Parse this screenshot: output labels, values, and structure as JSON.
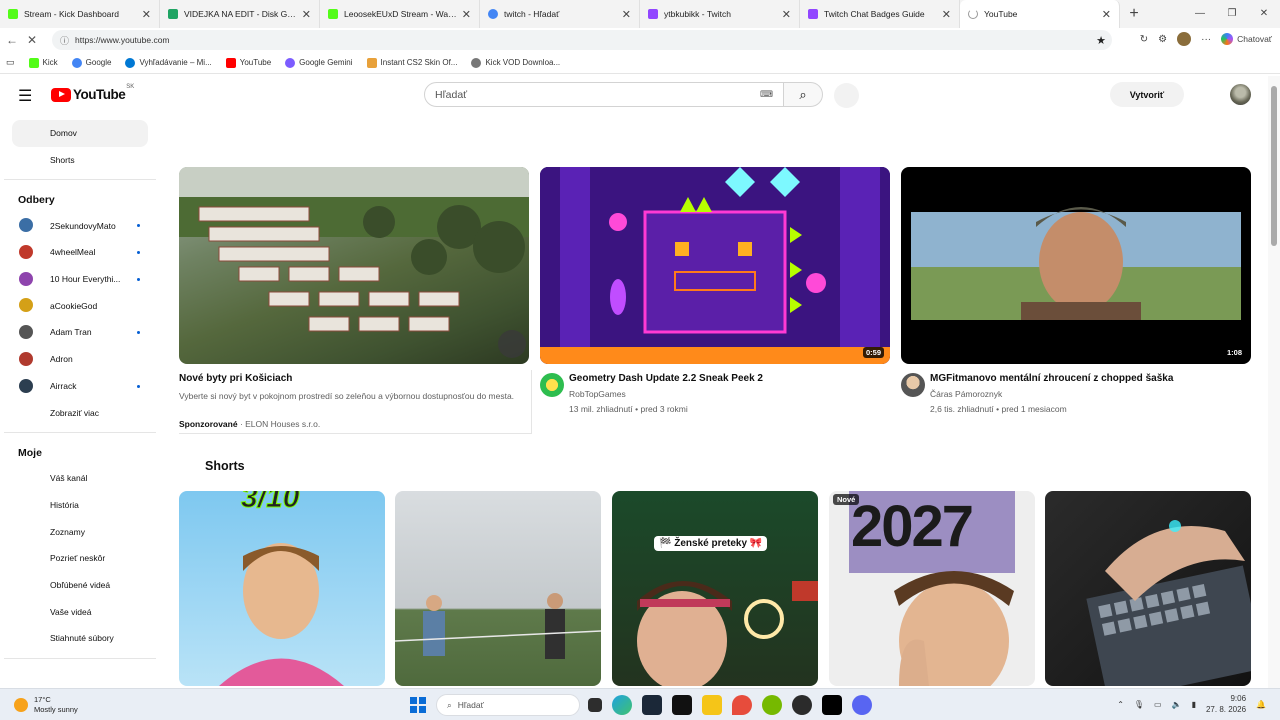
{
  "browser": {
    "tabs": [
      {
        "title": "Stream - Kick Dashboard",
        "color": "#53fc18",
        "active": false
      },
      {
        "title": "VIDEJKA NA EDIT - Disk Google",
        "color": "#1fa463",
        "active": false
      },
      {
        "title": "LeoosekEUxD Stream - Watch Live",
        "color": "#53fc18",
        "active": false
      },
      {
        "title": "twitch - Hľadať",
        "color": "#4285f4",
        "active": false
      },
      {
        "title": "ytbkubikk - Twitch",
        "color": "#9146ff",
        "active": false
      },
      {
        "title": "Twitch Chat Badges Guide",
        "color": "#9146ff",
        "active": false
      },
      {
        "title": "YouTube",
        "color": "#999999",
        "active": true
      }
    ],
    "url": "https://www.youtube.com",
    "copilot_label": "Chatovať",
    "bookmarks": [
      {
        "label": "Kick",
        "color": "#53fc18"
      },
      {
        "label": "Google",
        "color": "#4285f4"
      },
      {
        "label": "Vyhľadávanie – Mi...",
        "color": "#0078d4"
      },
      {
        "label": "YouTube",
        "color": "#ff0000"
      },
      {
        "label": "Google Gemini",
        "color": "#7c5cff"
      },
      {
        "label": "Instant CS2 Skin Of...",
        "color": "#e8a13a"
      },
      {
        "label": "Kick VOD Downloa...",
        "color": "#777777"
      }
    ]
  },
  "youtube": {
    "logo_text": "YouTube",
    "country_code": "SK",
    "search_placeholder": "Hľadať",
    "create_label": "Vytvoriť"
  },
  "sidebar": {
    "home": "Domov",
    "shorts": "Shorts",
    "subscriptions_title": "Odbery",
    "subscriptions": [
      {
        "name": "2SekundovyMato",
        "color": "#3b6ea5",
        "new": true
      },
      {
        "name": "4wheelMeal",
        "color": "#c0392b",
        "new": true
      },
      {
        "name": "10 Hour Everythi...",
        "color": "#8e44ad",
        "new": true
      },
      {
        "name": "aCookieGod",
        "color": "#d4a017",
        "new": false
      },
      {
        "name": "Adam Tran",
        "color": "#555555",
        "new": true
      },
      {
        "name": "Adron",
        "color": "#b03a2e",
        "new": false
      },
      {
        "name": "Airrack",
        "color": "#2c3e50",
        "new": true
      }
    ],
    "show_more": "Zobraziť viac",
    "you_title": "Moje",
    "you_items": [
      "Váš kanál",
      "História",
      "Zoznamy",
      "Pozrieť neskôr",
      "Obľúbené videá",
      "Vaše videá",
      "Stiahnuté súbory"
    ]
  },
  "videos": [
    {
      "title": "Nové byty pri Košiciach",
      "description": "Vyberte si nový byt v pokojnom prostredí so zeleňou a výbornou dostupnosťou do mesta.",
      "sponsored": "Sponzorované",
      "advertiser": "· ELON Houses s.r.o."
    },
    {
      "title": "Geometry Dash Update 2.2 Sneak Peek 2",
      "channel": "RobTopGames",
      "meta": "13 mil. zhliadnutí • pred 3 rokmi",
      "duration": "0:59"
    },
    {
      "title": "MGFitmanovo mentální zhroucení z chopped šaška",
      "channel": "Čáras Pámoroznyk",
      "meta": "2,6 tis. zhliadnutí • pred 1 mesiacom",
      "duration": "1:08"
    }
  ],
  "shorts": {
    "title": "Shorts",
    "items": [
      {
        "overlay": "3/10"
      },
      {
        "overlay": ""
      },
      {
        "overlay": "🏁 Ženské preteky 🎀"
      },
      {
        "overlay": "2027",
        "badge": "Nové"
      },
      {
        "overlay": ""
      }
    ]
  },
  "taskbar": {
    "temperature": "17°C",
    "weather": "Mostly sunny",
    "search_placeholder": "Hľadať",
    "time": "9:06",
    "date": "27. 8. 2026"
  }
}
